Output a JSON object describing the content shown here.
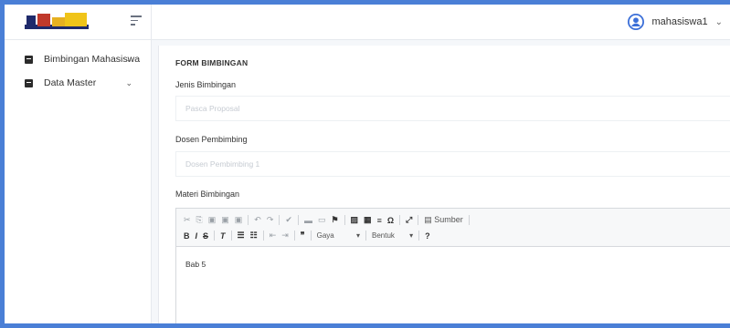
{
  "user": {
    "name": "mahasiswa1"
  },
  "sidebar": {
    "items": [
      {
        "label": "Bimbingan Mahasiswa"
      },
      {
        "label": "Data Master"
      }
    ]
  },
  "form": {
    "title": "FORM BIMBINGAN",
    "jenis_label": "Jenis Bimbingan",
    "jenis_placeholder": "Pasca Proposal",
    "dosen_label": "Dosen Pembimbing",
    "dosen_placeholder": "Dosen Pembimbing 1",
    "materi_label": "Materi Bimbingan"
  },
  "editor": {
    "source_label": "Sumber",
    "style_label": "Gaya",
    "format_label": "Bentuk",
    "help_label": "?",
    "content": "Bab 5"
  },
  "colors": {
    "frame": "#4a7fd6",
    "accent": "#3b6fd8"
  }
}
